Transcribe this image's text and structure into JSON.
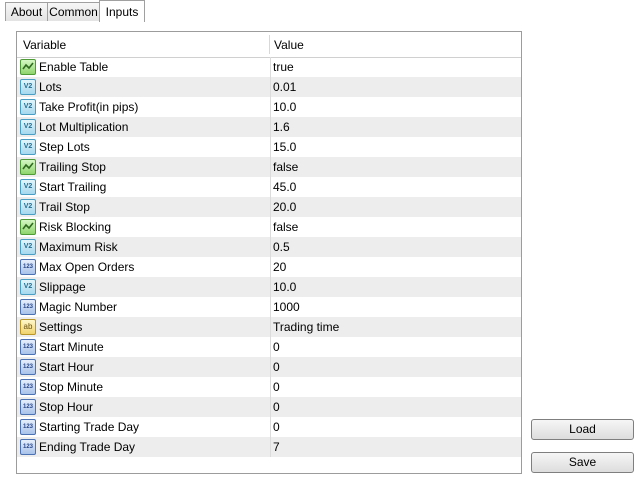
{
  "tabs": [
    {
      "label": "About",
      "active": false
    },
    {
      "label": "Common",
      "active": false
    },
    {
      "label": "Inputs",
      "active": true
    }
  ],
  "table": {
    "headers": {
      "variable": "Variable",
      "value": "Value"
    },
    "rows": [
      {
        "name": "Enable Table",
        "value": "true",
        "type": "bool"
      },
      {
        "name": "Lots",
        "value": "0.01",
        "type": "double"
      },
      {
        "name": "Take Profit(in pips)",
        "value": "10.0",
        "type": "double"
      },
      {
        "name": "Lot Multiplication",
        "value": "1.6",
        "type": "double"
      },
      {
        "name": "Step Lots",
        "value": "15.0",
        "type": "double"
      },
      {
        "name": "Trailing Stop",
        "value": "false",
        "type": "bool"
      },
      {
        "name": "Start Trailing",
        "value": "45.0",
        "type": "double"
      },
      {
        "name": "Trail Stop",
        "value": "20.0",
        "type": "double"
      },
      {
        "name": "Risk Blocking",
        "value": "false",
        "type": "bool"
      },
      {
        "name": "Maximum Risk",
        "value": "0.5",
        "type": "double"
      },
      {
        "name": "Max Open Orders",
        "value": "20",
        "type": "int"
      },
      {
        "name": "Slippage",
        "value": "10.0",
        "type": "double"
      },
      {
        "name": "Magic Number",
        "value": "1000",
        "type": "int"
      },
      {
        "name": "Settings",
        "value": "Trading time",
        "type": "string"
      },
      {
        "name": "Start Minute",
        "value": "0",
        "type": "int"
      },
      {
        "name": "Start Hour",
        "value": "0",
        "type": "int"
      },
      {
        "name": "Stop Minute",
        "value": "0",
        "type": "int"
      },
      {
        "name": "Stop Hour",
        "value": "0",
        "type": "int"
      },
      {
        "name": "Starting Trade Day",
        "value": "0",
        "type": "int"
      },
      {
        "name": "Ending Trade Day",
        "value": "7",
        "type": "int"
      }
    ]
  },
  "icons": {
    "bool": "bool-checkmark-icon",
    "double": "double-variable-icon",
    "int": "integer-variable-icon",
    "string": "string-variable-icon"
  },
  "buttons": {
    "load": "Load",
    "save": "Save"
  }
}
